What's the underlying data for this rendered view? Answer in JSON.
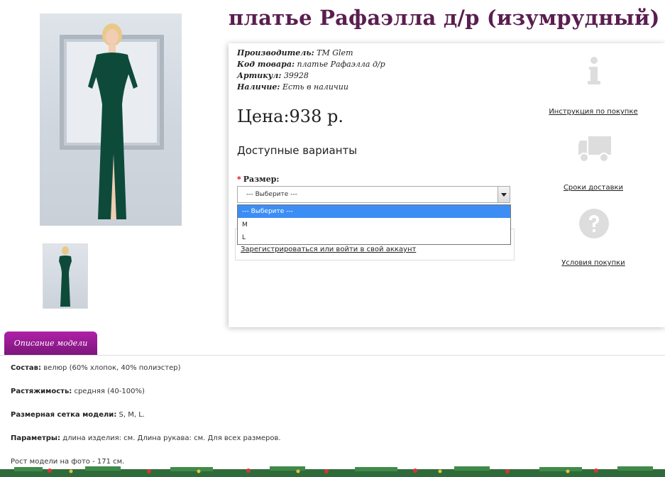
{
  "product": {
    "title": "платье Рафаэлла д/р (изумрудный)",
    "specs": [
      {
        "label": "Производитель:",
        "value": "ТМ Glem"
      },
      {
        "label": "Код товара:",
        "value": "платье Рафаэлла д/р"
      },
      {
        "label": "Артикул:",
        "value": "39928"
      },
      {
        "label": "Наличие:",
        "value": "Есть в наличии"
      }
    ],
    "price": "Цена:938 р.",
    "variants_heading": "Доступные варианты",
    "size": {
      "required_mark": "*",
      "label": "Размер:",
      "selected": "--- Выберите ---",
      "options": [
        "--- Выберите ---",
        "M",
        "L"
      ]
    },
    "login_link": "Зарегистрироваться или войти в свой аккаунт"
  },
  "sidebar": {
    "items": [
      {
        "icon": "info-icon",
        "label": "Инструкция по покупке"
      },
      {
        "icon": "delivery-truck-icon",
        "label": "Сроки доставки"
      },
      {
        "icon": "question-icon",
        "label": "Условия покупки"
      }
    ]
  },
  "tabs": {
    "description_label": "Описание модели"
  },
  "description": [
    {
      "label": "Состав:",
      "value": " велюр (60% хлопок, 40% полиэстер)"
    },
    {
      "label": "Растяжимость:",
      "value": " средняя (40-100%)"
    },
    {
      "label": "Размерная сетка модели:",
      "value": " S, M, L."
    },
    {
      "label": "Параметры:",
      "value": " длина изделия: см. Длина рукава: см. Для всех размеров."
    },
    {
      "label": "",
      "value": "Рост модели на фото - 171 см."
    }
  ],
  "colors": {
    "title": "#5a1e4f",
    "tab": "#9b1d94",
    "dropdown_active": "#3c8ef5",
    "dress": "#0e4a3a"
  }
}
